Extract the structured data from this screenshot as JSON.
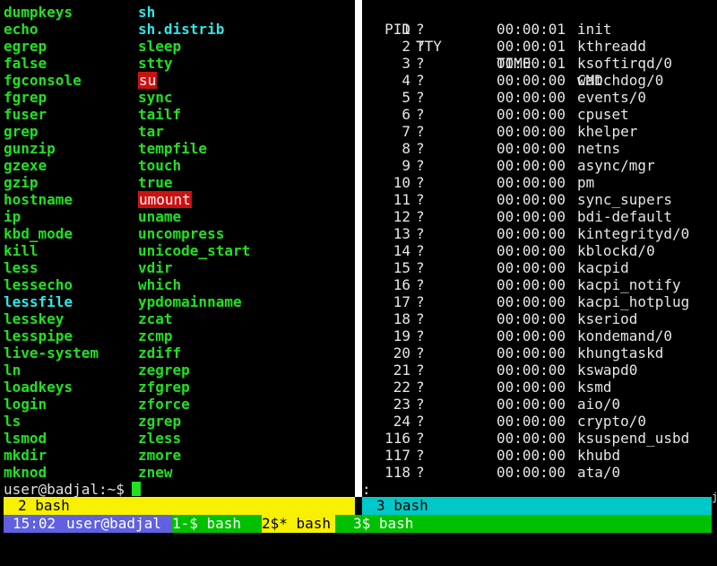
{
  "left_pane": {
    "col1": [
      {
        "name": "dumpkeys",
        "kind": "exec"
      },
      {
        "name": "echo",
        "kind": "exec"
      },
      {
        "name": "egrep",
        "kind": "exec"
      },
      {
        "name": "false",
        "kind": "exec"
      },
      {
        "name": "fgconsole",
        "kind": "exec"
      },
      {
        "name": "fgrep",
        "kind": "exec"
      },
      {
        "name": "fuser",
        "kind": "exec"
      },
      {
        "name": "grep",
        "kind": "exec"
      },
      {
        "name": "gunzip",
        "kind": "exec"
      },
      {
        "name": "gzexe",
        "kind": "exec"
      },
      {
        "name": "gzip",
        "kind": "exec"
      },
      {
        "name": "hostname",
        "kind": "exec"
      },
      {
        "name": "ip",
        "kind": "exec"
      },
      {
        "name": "kbd_mode",
        "kind": "exec"
      },
      {
        "name": "kill",
        "kind": "exec"
      },
      {
        "name": "less",
        "kind": "exec"
      },
      {
        "name": "lessecho",
        "kind": "exec"
      },
      {
        "name": "lessfile",
        "kind": "link"
      },
      {
        "name": "lesskey",
        "kind": "exec"
      },
      {
        "name": "lesspipe",
        "kind": "exec"
      },
      {
        "name": "live-system",
        "kind": "exec"
      },
      {
        "name": "ln",
        "kind": "exec"
      },
      {
        "name": "loadkeys",
        "kind": "exec"
      },
      {
        "name": "login",
        "kind": "exec"
      },
      {
        "name": "ls",
        "kind": "exec"
      },
      {
        "name": "lsmod",
        "kind": "exec"
      },
      {
        "name": "mkdir",
        "kind": "exec"
      },
      {
        "name": "mknod",
        "kind": "exec"
      }
    ],
    "col2": [
      {
        "name": "sh",
        "kind": "link"
      },
      {
        "name": "sh.distrib",
        "kind": "link"
      },
      {
        "name": "sleep",
        "kind": "exec"
      },
      {
        "name": "stty",
        "kind": "exec"
      },
      {
        "name": "su",
        "kind": "setuid"
      },
      {
        "name": "sync",
        "kind": "exec"
      },
      {
        "name": "tailf",
        "kind": "exec"
      },
      {
        "name": "tar",
        "kind": "exec"
      },
      {
        "name": "tempfile",
        "kind": "exec"
      },
      {
        "name": "touch",
        "kind": "exec"
      },
      {
        "name": "true",
        "kind": "exec"
      },
      {
        "name": "umount",
        "kind": "setuid"
      },
      {
        "name": "uname",
        "kind": "exec"
      },
      {
        "name": "uncompress",
        "kind": "exec"
      },
      {
        "name": "unicode_start",
        "kind": "exec"
      },
      {
        "name": "vdir",
        "kind": "exec"
      },
      {
        "name": "which",
        "kind": "exec"
      },
      {
        "name": "ypdomainname",
        "kind": "exec"
      },
      {
        "name": "zcat",
        "kind": "exec"
      },
      {
        "name": "zcmp",
        "kind": "exec"
      },
      {
        "name": "zdiff",
        "kind": "exec"
      },
      {
        "name": "zegrep",
        "kind": "exec"
      },
      {
        "name": "zfgrep",
        "kind": "exec"
      },
      {
        "name": "zforce",
        "kind": "exec"
      },
      {
        "name": "zgrep",
        "kind": "exec"
      },
      {
        "name": "zless",
        "kind": "exec"
      },
      {
        "name": "zmore",
        "kind": "exec"
      },
      {
        "name": "znew",
        "kind": "exec"
      }
    ],
    "prompt": "user@badjal:~$"
  },
  "right_pane": {
    "headers": {
      "pid": "PID",
      "tty": "TTY",
      "time": "TIME",
      "cmd": "CMD"
    },
    "rows": [
      {
        "pid": "1",
        "tty": "?",
        "time": "00:00:01",
        "cmd": "init"
      },
      {
        "pid": "2",
        "tty": "?",
        "time": "00:00:01",
        "cmd": "kthreadd"
      },
      {
        "pid": "3",
        "tty": "?",
        "time": "00:00:01",
        "cmd": "ksoftirqd/0"
      },
      {
        "pid": "4",
        "tty": "?",
        "time": "00:00:00",
        "cmd": "watchdog/0"
      },
      {
        "pid": "5",
        "tty": "?",
        "time": "00:00:00",
        "cmd": "events/0"
      },
      {
        "pid": "6",
        "tty": "?",
        "time": "00:00:00",
        "cmd": "cpuset"
      },
      {
        "pid": "7",
        "tty": "?",
        "time": "00:00:00",
        "cmd": "khelper"
      },
      {
        "pid": "8",
        "tty": "?",
        "time": "00:00:00",
        "cmd": "netns"
      },
      {
        "pid": "9",
        "tty": "?",
        "time": "00:00:00",
        "cmd": "async/mgr"
      },
      {
        "pid": "10",
        "tty": "?",
        "time": "00:00:00",
        "cmd": "pm"
      },
      {
        "pid": "11",
        "tty": "?",
        "time": "00:00:00",
        "cmd": "sync_supers"
      },
      {
        "pid": "12",
        "tty": "?",
        "time": "00:00:00",
        "cmd": "bdi-default"
      },
      {
        "pid": "13",
        "tty": "?",
        "time": "00:00:00",
        "cmd": "kintegrityd/0"
      },
      {
        "pid": "14",
        "tty": "?",
        "time": "00:00:00",
        "cmd": "kblockd/0"
      },
      {
        "pid": "15",
        "tty": "?",
        "time": "00:00:00",
        "cmd": "kacpid"
      },
      {
        "pid": "16",
        "tty": "?",
        "time": "00:00:00",
        "cmd": "kacpi_notify"
      },
      {
        "pid": "17",
        "tty": "?",
        "time": "00:00:00",
        "cmd": "kacpi_hotplug"
      },
      {
        "pid": "18",
        "tty": "?",
        "time": "00:00:00",
        "cmd": "kseriod"
      },
      {
        "pid": "19",
        "tty": "?",
        "time": "00:00:00",
        "cmd": "kondemand/0"
      },
      {
        "pid": "20",
        "tty": "?",
        "time": "00:00:00",
        "cmd": "khungtaskd"
      },
      {
        "pid": "21",
        "tty": "?",
        "time": "00:00:00",
        "cmd": "kswapd0"
      },
      {
        "pid": "22",
        "tty": "?",
        "time": "00:00:00",
        "cmd": "ksmd"
      },
      {
        "pid": "23",
        "tty": "?",
        "time": "00:00:00",
        "cmd": "aio/0"
      },
      {
        "pid": "24",
        "tty": "?",
        "time": "00:00:00",
        "cmd": "crypto/0"
      },
      {
        "pid": "116",
        "tty": "?",
        "time": "00:00:00",
        "cmd": "ksuspend_usbd"
      },
      {
        "pid": "117",
        "tty": "?",
        "time": "00:00:00",
        "cmd": "khubd"
      },
      {
        "pid": "118",
        "tty": "?",
        "time": "00:00:00",
        "cmd": "ata/0"
      }
    ],
    "prompt": ":",
    "edge_mark": "j"
  },
  "window_bar": {
    "left": "2 bash",
    "right": "3 bash"
  },
  "status_bar": {
    "clock": "15:02",
    "user": "user@badjal",
    "w1": "1-$ bash",
    "w2": "2$* bash",
    "w3": "3$ bash"
  },
  "colors": {
    "exec": "#22e022",
    "link": "#2ee6e6",
    "setuid_bg": "#cc1111",
    "bar_yellow": "#f7f000",
    "bar_cyan": "#00c8c8",
    "bar_green": "#00c000",
    "bar_blue": "#6060e0"
  }
}
